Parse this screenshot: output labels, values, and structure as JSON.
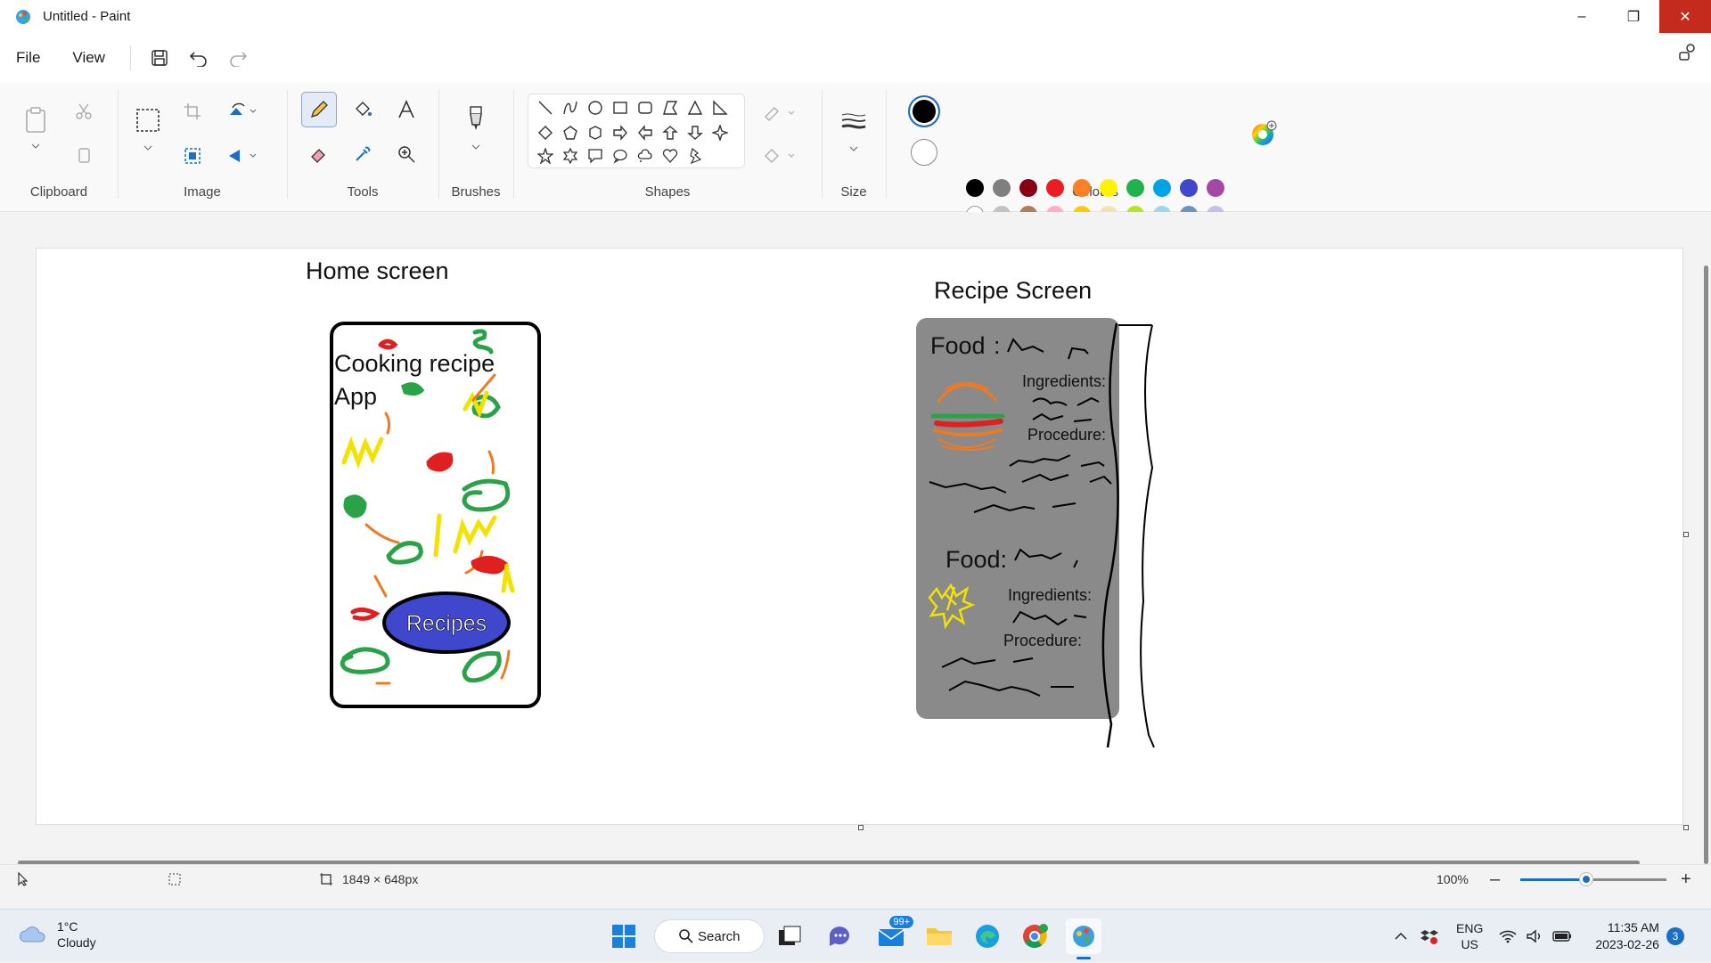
{
  "window": {
    "title": "Untitled - Paint",
    "controls": {
      "minimize": "–",
      "restore": "❐",
      "close": "✕"
    }
  },
  "menu": {
    "file": "File",
    "view": "View"
  },
  "ribbon": {
    "groups": {
      "clipboard": "Clipboard",
      "image": "Image",
      "tools": "Tools",
      "brushes": "Brushes",
      "shapes": "Shapes",
      "size": "Size",
      "colours": "Colours"
    },
    "active_tool": "pencil",
    "primary_colour": "#000000",
    "secondary_colour": "#ffffff",
    "palette_row1": [
      "#000000",
      "#7f7f7f",
      "#880015",
      "#ed1c24",
      "#ff7f27",
      "#fff200",
      "#22b14c",
      "#00a2e8",
      "#3f48cc",
      "#a349a4"
    ],
    "palette_row2": [
      "#ffffff",
      "#c3c3c3",
      "#b97a57",
      "#ffaec9",
      "#ffc90e",
      "#efe4b0",
      "#b5e61d",
      "#99d9ea",
      "#7092be",
      "#c8bfe7"
    ]
  },
  "canvas": {
    "home_heading": "Home screen",
    "recipe_heading": "Recipe Screen",
    "app_title_line1": "Cooking recipe",
    "app_title_line2": "App",
    "recipes_button": "Recipes",
    "food_label": "Food",
    "food_colon": ":",
    "ingredients_label": "Ingredients:",
    "procedure_label": "Procedure:",
    "food_label_2": "Food:",
    "ingredients_label_2": "Ingredients:",
    "procedure_label_2": "Procedure:"
  },
  "status": {
    "canvas_size": "1849 × 648px",
    "zoom": "100%",
    "zoom_level": 0.45
  },
  "taskbar": {
    "weather_temp": "1°C",
    "weather_desc": "Cloudy",
    "search": "Search",
    "mail_badge": "99+",
    "lang_line1": "ENG",
    "lang_line2": "US",
    "time": "11:35 AM",
    "date": "2023-02-26",
    "notification_count": "3"
  }
}
